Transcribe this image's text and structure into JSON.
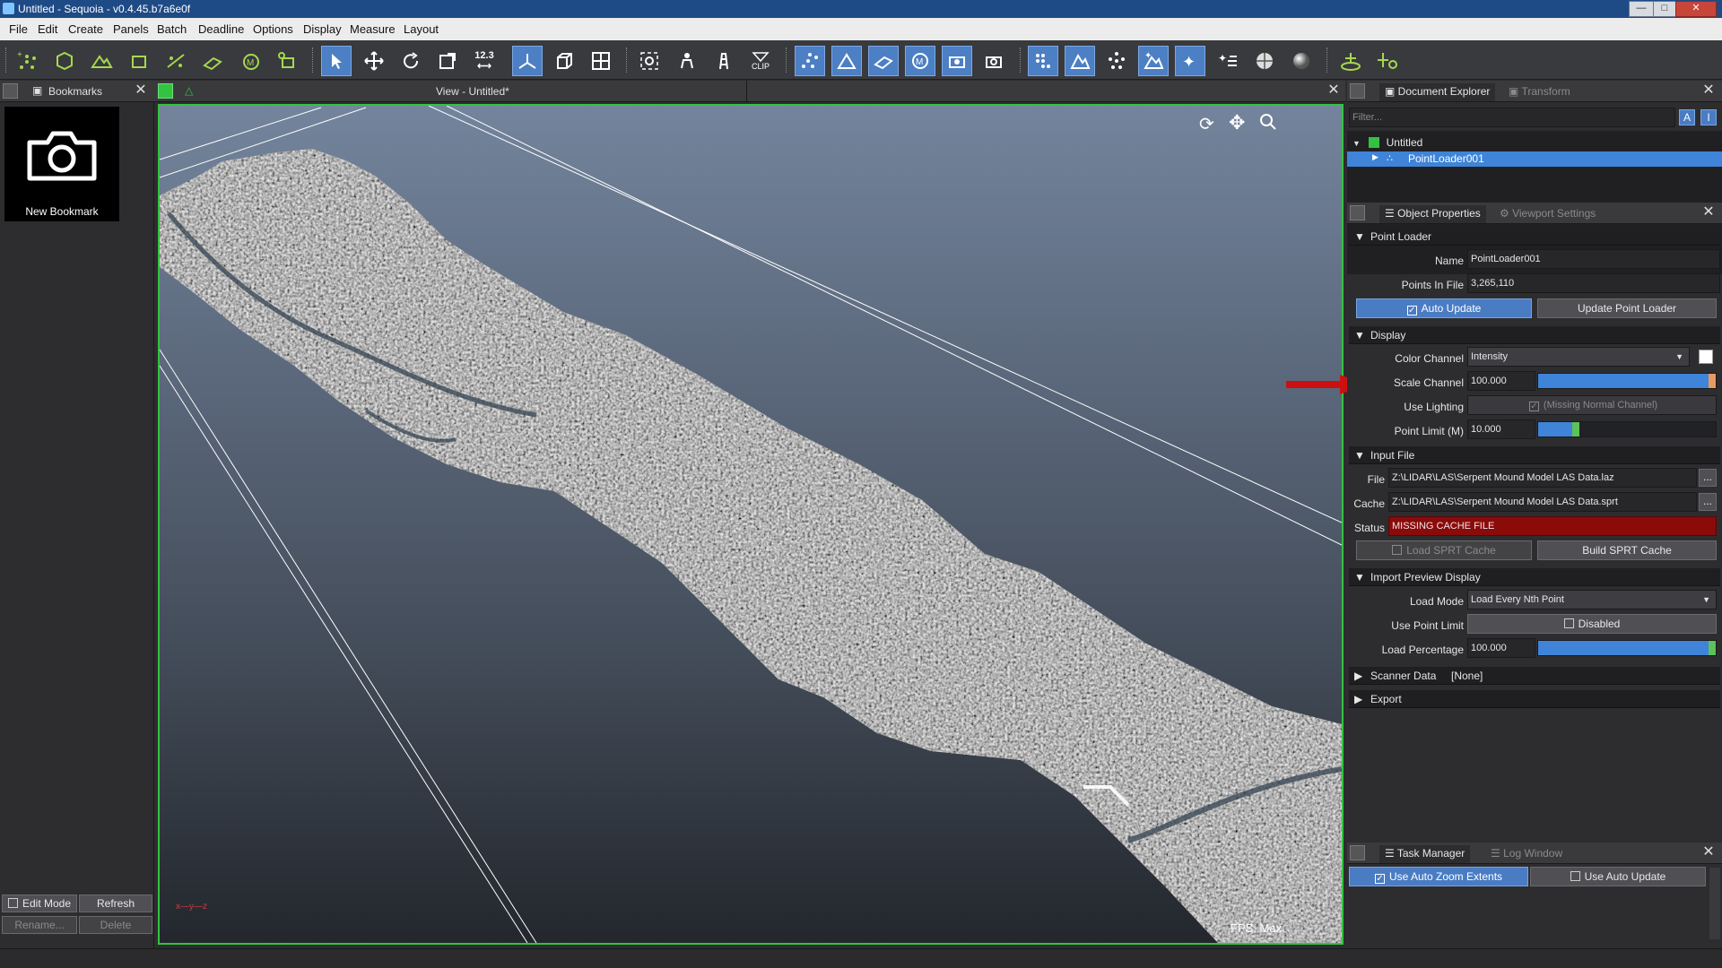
{
  "window": {
    "title": "Untitled - Sequoia - v0.4.45.b7a6e0f",
    "minimize": "—",
    "maximize": "□",
    "close": "✕"
  },
  "menu": [
    "File",
    "Edit",
    "Create",
    "Panels",
    "Batch",
    "Deadline",
    "Options",
    "Display",
    "Measure",
    "Layout"
  ],
  "toolbar": {
    "measure_label": "12.3",
    "clip_label": "CLIP",
    "icons": [
      "point-loader-icon",
      "mesh-loader-icon",
      "terrain-icon",
      "batch-icon",
      "scatter-icon",
      "sheet-icon",
      "m-icon",
      "cloud-add-icon",
      "select-icon",
      "move-icon",
      "rotate-icon",
      "scale-icon",
      "measure-icon",
      "axis-icon",
      "cube-icon",
      "grid-icon",
      "focus-icon",
      "person-icon",
      "tower-icon",
      "clip-icon",
      "points-icon",
      "triangle-points-icon",
      "sheet-points-icon",
      "m-points-icon",
      "camera-points-icon",
      "camera-icon",
      "grid-points-icon",
      "mountain-icon",
      "star-points-icon",
      "star-mountain-icon",
      "sparkle-icon",
      "star-lines-icon",
      "globe-icon",
      "sphere-icon",
      "ground-icon",
      "plus-icon"
    ]
  },
  "bookmarks": {
    "title": "Bookmarks",
    "new_bookmark": "New Bookmark",
    "edit_mode": "Edit Mode",
    "refresh": "Refresh",
    "rename": "Rename...",
    "delete": "Delete"
  },
  "viewport": {
    "title": "View - Untitled*",
    "fps": "FPS:  Max",
    "axes": "x—y—z"
  },
  "document_explorer": {
    "tab_active": "Document Explorer",
    "tab_other": "Transform",
    "filter_placeholder": "Filter...",
    "btn_a": "A",
    "btn_i": "I",
    "tree": [
      {
        "label": "Untitled",
        "expanded": true
      },
      {
        "label": "PointLoader001",
        "selected": true
      }
    ]
  },
  "object_properties": {
    "tab_active": "Object Properties",
    "tab_other": "Viewport Settings",
    "point_loader": {
      "section": "Point Loader",
      "name_label": "Name",
      "name_value": "PointLoader001",
      "points_label": "Points In File",
      "points_value": "3,265,110",
      "auto_update": "Auto Update",
      "update_btn": "Update Point Loader"
    },
    "display": {
      "section": "Display",
      "color_channel_label": "Color Channel",
      "color_channel_value": "Intensity",
      "scale_label": "Scale Channel",
      "scale_value": "100.000",
      "scale_fraction": 1.0,
      "lighting_label": "Use Lighting",
      "lighting_value": "(Missing Normal Channel)",
      "point_limit_label": "Point Limit (M)",
      "point_limit_value": "10.000",
      "point_limit_fraction": 0.2
    },
    "input_file": {
      "section": "Input File",
      "file_label": "File",
      "file_value": "Z:\\LIDAR\\LAS\\Serpent Mound Model LAS Data.laz",
      "cache_label": "Cache",
      "cache_value": "Z:\\LIDAR\\LAS\\Serpent Mound Model LAS Data.sprt",
      "status_label": "Status",
      "status_value": "MISSING CACHE FILE",
      "browse": "...",
      "load_sprt": "Load SPRT Cache",
      "build_sprt": "Build SPRT Cache"
    },
    "import_preview": {
      "section": "Import Preview Display",
      "load_mode_label": "Load Mode",
      "load_mode_value": "Load Every Nth Point",
      "use_limit_label": "Use Point Limit",
      "use_limit_value": "Disabled",
      "load_pct_label": "Load Percentage",
      "load_pct_value": "100.000",
      "load_pct_fraction": 1.0
    },
    "scanner_data": {
      "section": "Scanner Data",
      "value": "[None]"
    },
    "export": {
      "section": "Export"
    }
  },
  "task_manager": {
    "tab_active": "Task Manager",
    "tab_other": "Log Window",
    "auto_zoom": "Use Auto Zoom Extents",
    "auto_update": "Use Auto Update"
  },
  "colors": {
    "accent_blue": "#4a7cc4",
    "viewport_border": "#34c242",
    "status_red": "#8b0a0a",
    "arrow_red": "#cc1010"
  }
}
